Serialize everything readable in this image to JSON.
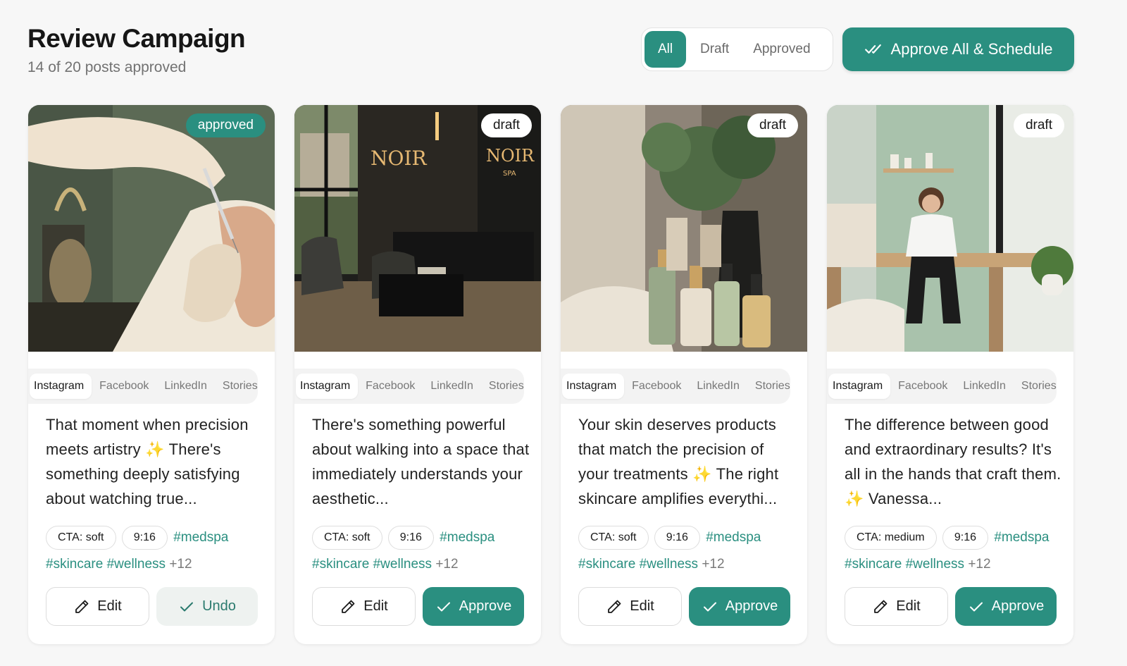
{
  "header": {
    "title": "Review Campaign",
    "subtitle": "14 of 20 posts approved"
  },
  "filters": {
    "all": "All",
    "draft": "Draft",
    "approved": "Approved",
    "active": "All"
  },
  "approve_all_label": "Approve All & Schedule",
  "colors": {
    "accent": "#2a8f80",
    "hashtag": "#2a8f80"
  },
  "posts": [
    {
      "status": "approved",
      "platforms": [
        "Instagram",
        "Facebook",
        "LinkedIn",
        "Stories"
      ],
      "active_platform": "Instagram",
      "caption": "That moment when precision meets artistry ✨ There's something deeply satisfying about watching true...",
      "cta": "CTA: soft",
      "ratio": "9:16",
      "hashtags": [
        "#medspa",
        "#skincare",
        "#wellness"
      ],
      "more": "+12",
      "edit_label": "Edit",
      "primary_label": "Undo"
    },
    {
      "status": "draft",
      "platforms": [
        "Instagram",
        "Facebook",
        "LinkedIn",
        "Stories"
      ],
      "active_platform": "Instagram",
      "caption": "There's something powerful about walking into a space that immediately understands your aesthetic...",
      "cta": "CTA: soft",
      "ratio": "9:16",
      "hashtags": [
        "#medspa",
        "#skincare",
        "#wellness"
      ],
      "more": "+12",
      "edit_label": "Edit",
      "primary_label": "Approve",
      "sign_text": "NOIR",
      "sign_sub": "SPA"
    },
    {
      "status": "draft",
      "platforms": [
        "Instagram",
        "Facebook",
        "LinkedIn",
        "Stories"
      ],
      "active_platform": "Instagram",
      "caption": "Your skin deserves products that match the precision of your treatments ✨ The right skincare amplifies everythi...",
      "cta": "CTA: soft",
      "ratio": "9:16",
      "hashtags": [
        "#medspa",
        "#skincare",
        "#wellness"
      ],
      "more": "+12",
      "edit_label": "Edit",
      "primary_label": "Approve"
    },
    {
      "status": "draft",
      "platforms": [
        "Instagram",
        "Facebook",
        "LinkedIn",
        "Stories"
      ],
      "active_platform": "Instagram",
      "caption": "The difference between good and extraordinary results? It's all in the hands that craft them. ✨ Vanessa...",
      "cta": "CTA: medium",
      "ratio": "9:16",
      "hashtags": [
        "#medspa",
        "#skincare",
        "#wellness"
      ],
      "more": "+12",
      "edit_label": "Edit",
      "primary_label": "Approve"
    }
  ]
}
